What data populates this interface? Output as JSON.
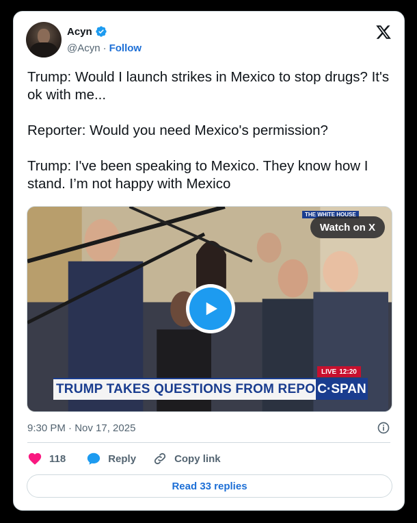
{
  "author": {
    "name": "Acyn",
    "handle": "@Acyn",
    "separator": "·",
    "follow_label": "Follow",
    "verified": true
  },
  "tweet": {
    "text": "Trump: Would I launch strikes in Mexico to stop drugs? It's ok with me...\n\nReporter: Would you need Mexico's permission?\n\nTrump: I've been speaking to Mexico. They know how I stand. I’m not happy with Mexico"
  },
  "media": {
    "watch_label": "Watch on X",
    "chyron": "TRUMP TAKES QUESTIONS FROM REPORTERS",
    "network": "C·SPAN",
    "live_label": "LIVE",
    "live_time": "12:20",
    "corner_tag": "THE WHITE HOUSE"
  },
  "timestamp": "9:30 PM · Nov 17, 2025",
  "actions": {
    "like_count": "118",
    "reply_label": "Reply",
    "copy_label": "Copy link"
  },
  "read_replies_label": "Read 33 replies",
  "colors": {
    "accent": "#1d9bf0",
    "link": "#1d6fd6",
    "like": "#f91880",
    "muted": "#536471"
  }
}
